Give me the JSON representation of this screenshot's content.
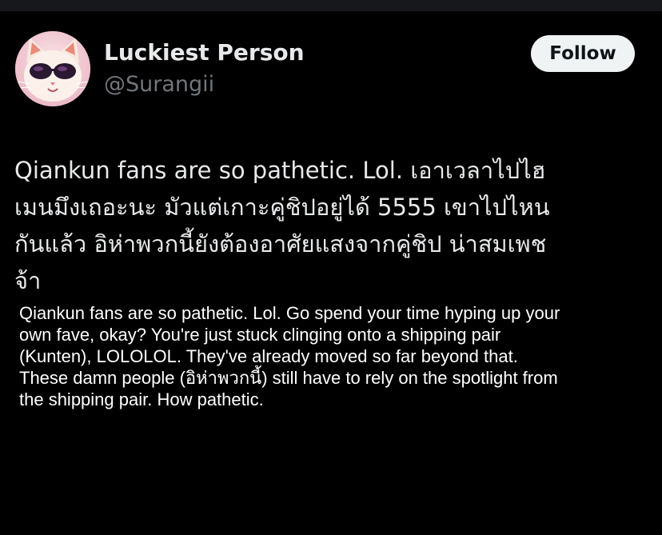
{
  "author": {
    "display_name": "Luckiest Person",
    "handle": "@Surangii",
    "avatar_icon": "cat-with-sunglasses-avatar"
  },
  "follow_button": {
    "label": "Follow"
  },
  "tweet": {
    "lines": [
      "Qiankun fans are so pathetic. Lol. เอาเวลาไปไฮ",
      "เมนมึงเถอะนะ มัวแต่เกาะคู่ชิปอยู่ได้ 5555 เขาไปไหน",
      "กันแล้ว อิห่าพวกนี้ยังต้องอาศัยแสงจากคู่ชิป น่าสมเพช",
      "จ้า"
    ]
  },
  "translation": {
    "lines": [
      "Qiankun fans are so pathetic. Lol. Go spend your time hyping up your",
      "own fave, okay? You're just stuck clinging onto a shipping pair",
      "(Kunten), LOLOLOL. They've already moved so far beyond that.",
      "These damn people (อิห่าพวกนี้) still have to rely on the spotlight from",
      "the shipping pair. How pathetic."
    ]
  },
  "colors": {
    "background": "#000000",
    "primary_text": "#e7e9ea",
    "secondary_text": "#71767b",
    "button_bg": "#eff3f4",
    "button_text": "#0f1419"
  }
}
